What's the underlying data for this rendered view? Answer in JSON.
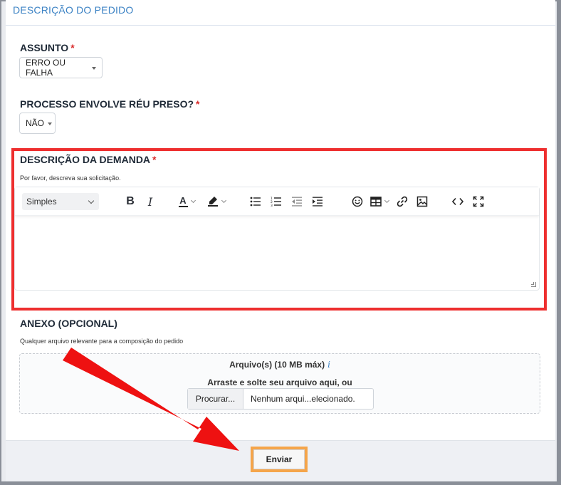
{
  "section": {
    "title": "DESCRIÇÃO DO PEDIDO"
  },
  "assunto": {
    "label": "ASSUNTO",
    "required": "*",
    "selected": "ERRO OU FALHA"
  },
  "reu_preso": {
    "label": "PROCESSO ENVOLVE RÉU PRESO?",
    "required": "*",
    "selected": "NÃO"
  },
  "demanda": {
    "label": "DESCRIÇÃO DA DEMANDA",
    "required": "*",
    "help": "Por favor, descreva sua solicitação.",
    "editor": {
      "style_select": "Simples",
      "bold": "B",
      "italic": "I",
      "font_color": "A",
      "value": ""
    }
  },
  "anexo": {
    "label": "ANEXO (OPCIONAL)",
    "help": "Qualquer arquivo relevante para a composição do pedido",
    "files_title": "Arquivo(s) (10 MB máx)",
    "info_icon": "i",
    "drag_text": "Arraste e solte seu arquivo aqui, ou",
    "browse_label": "Procurar...",
    "file_name": "Nenhum arqui...elecionado."
  },
  "footer": {
    "submit_label": "Enviar"
  },
  "colors": {
    "accent": "#3b82c4",
    "required": "#d92d2d",
    "highlight_box": "#ee2f2f",
    "arrow": "#ee1111",
    "button_highlight": "#f5a54a"
  },
  "icons": {
    "toolbar": [
      "bold-icon",
      "italic-icon",
      "font-color-icon",
      "highlight-icon",
      "bullet-list-icon",
      "numbered-list-icon",
      "outdent-icon",
      "indent-icon",
      "emoji-icon",
      "table-icon",
      "link-icon",
      "image-icon",
      "code-view-icon",
      "fullscreen-icon"
    ],
    "annotation": "red-arrow-icon"
  }
}
